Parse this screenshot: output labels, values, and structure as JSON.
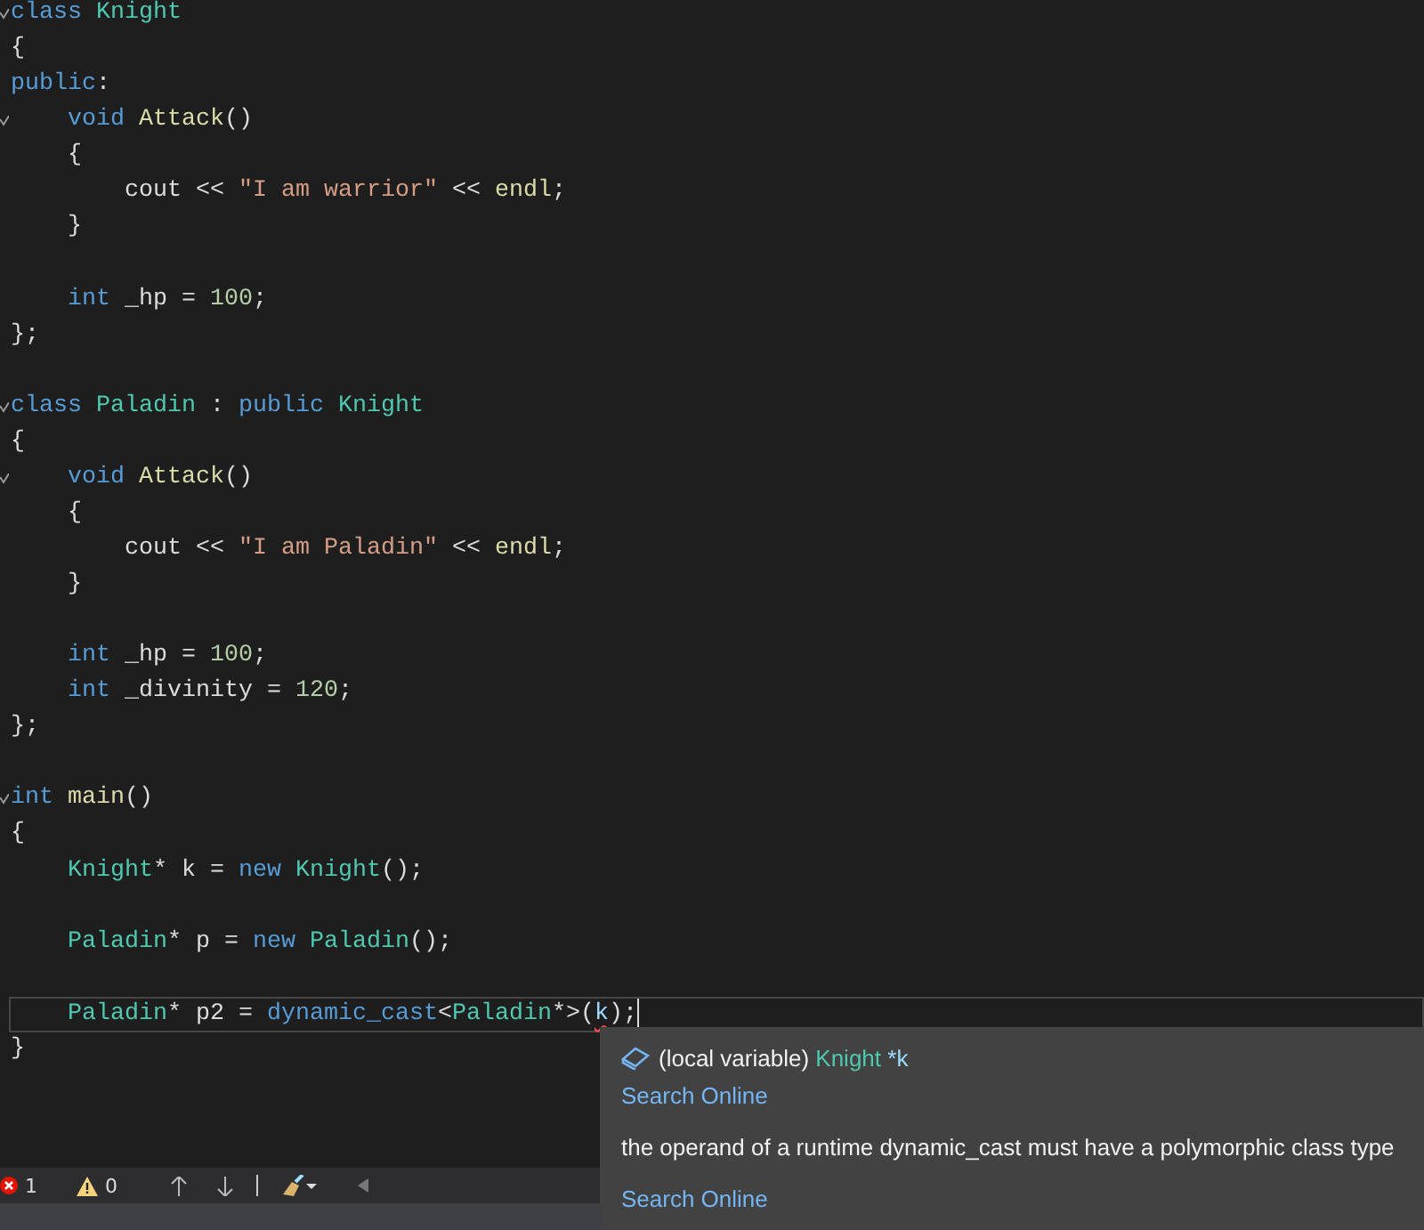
{
  "editor": {
    "lines": [
      {
        "fold": true,
        "current": false,
        "tokens": [
          {
            "kind": "keyword",
            "text": "class "
          },
          {
            "kind": "type",
            "text": "Knight"
          }
        ]
      },
      {
        "fold": false,
        "current": false,
        "tokens": [
          {
            "kind": "plain",
            "text": "{"
          }
        ]
      },
      {
        "fold": false,
        "current": false,
        "tokens": [
          {
            "kind": "keyword",
            "text": "public"
          },
          {
            "kind": "plain",
            "text": ":"
          }
        ]
      },
      {
        "fold": true,
        "current": false,
        "tokens": [
          {
            "kind": "keyword",
            "text": "    void "
          },
          {
            "kind": "func",
            "text": "Attack"
          },
          {
            "kind": "plain",
            "text": "()"
          }
        ]
      },
      {
        "fold": false,
        "current": false,
        "tokens": [
          {
            "kind": "plain",
            "text": "    {"
          }
        ]
      },
      {
        "fold": false,
        "current": false,
        "tokens": [
          {
            "kind": "plain",
            "text": "        cout << "
          },
          {
            "kind": "string",
            "text": "\"I am warrior\""
          },
          {
            "kind": "plain",
            "text": " << "
          },
          {
            "kind": "func",
            "text": "endl"
          },
          {
            "kind": "plain",
            "text": ";"
          }
        ]
      },
      {
        "fold": false,
        "current": false,
        "tokens": [
          {
            "kind": "plain",
            "text": "    }"
          }
        ]
      },
      {
        "fold": false,
        "current": false
      },
      {
        "fold": false,
        "current": false,
        "tokens": [
          {
            "kind": "keyword",
            "text": "    int "
          },
          {
            "kind": "plain",
            "text": "_hp = "
          },
          {
            "kind": "number",
            "text": "100"
          },
          {
            "kind": "plain",
            "text": ";"
          }
        ]
      },
      {
        "fold": false,
        "current": false,
        "tokens": [
          {
            "kind": "plain",
            "text": "};"
          }
        ]
      },
      {
        "fold": false,
        "current": false
      },
      {
        "fold": true,
        "current": false,
        "tokens": [
          {
            "kind": "keyword",
            "text": "class "
          },
          {
            "kind": "type",
            "text": "Paladin"
          },
          {
            "kind": "plain",
            "text": " : "
          },
          {
            "kind": "keyword",
            "text": "public "
          },
          {
            "kind": "type",
            "text": "Knight"
          }
        ]
      },
      {
        "fold": false,
        "current": false,
        "tokens": [
          {
            "kind": "plain",
            "text": "{"
          }
        ]
      },
      {
        "fold": true,
        "current": false,
        "tokens": [
          {
            "kind": "keyword",
            "text": "    void "
          },
          {
            "kind": "func",
            "text": "Attack"
          },
          {
            "kind": "plain",
            "text": "()"
          }
        ]
      },
      {
        "fold": false,
        "current": false,
        "tokens": [
          {
            "kind": "plain",
            "text": "    {"
          }
        ]
      },
      {
        "fold": false,
        "current": false,
        "tokens": [
          {
            "kind": "plain",
            "text": "        cout << "
          },
          {
            "kind": "string",
            "text": "\"I am Paladin\""
          },
          {
            "kind": "plain",
            "text": " << "
          },
          {
            "kind": "func",
            "text": "endl"
          },
          {
            "kind": "plain",
            "text": ";"
          }
        ]
      },
      {
        "fold": false,
        "current": false,
        "tokens": [
          {
            "kind": "plain",
            "text": "    }"
          }
        ]
      },
      {
        "fold": false,
        "current": false
      },
      {
        "fold": false,
        "current": false,
        "tokens": [
          {
            "kind": "keyword",
            "text": "    int "
          },
          {
            "kind": "plain",
            "text": "_hp = "
          },
          {
            "kind": "number",
            "text": "100"
          },
          {
            "kind": "plain",
            "text": ";"
          }
        ]
      },
      {
        "fold": false,
        "current": false,
        "tokens": [
          {
            "kind": "keyword",
            "text": "    int "
          },
          {
            "kind": "plain",
            "text": "_divinity = "
          },
          {
            "kind": "number",
            "text": "120"
          },
          {
            "kind": "plain",
            "text": ";"
          }
        ]
      },
      {
        "fold": false,
        "current": false,
        "tokens": [
          {
            "kind": "plain",
            "text": "};"
          }
        ]
      },
      {
        "fold": false,
        "current": false
      },
      {
        "fold": true,
        "current": false,
        "tokens": [
          {
            "kind": "keyword",
            "text": "int "
          },
          {
            "kind": "func",
            "text": "main"
          },
          {
            "kind": "plain",
            "text": "()"
          }
        ]
      },
      {
        "fold": false,
        "current": false,
        "tokens": [
          {
            "kind": "plain",
            "text": "{"
          }
        ]
      },
      {
        "fold": false,
        "current": false,
        "tokens": [
          {
            "kind": "type",
            "text": "    Knight"
          },
          {
            "kind": "plain",
            "text": "* k = "
          },
          {
            "kind": "keyword",
            "text": "new "
          },
          {
            "kind": "type",
            "text": "Knight"
          },
          {
            "kind": "plain",
            "text": "();"
          }
        ]
      },
      {
        "fold": false,
        "current": false
      },
      {
        "fold": false,
        "current": false,
        "tokens": [
          {
            "kind": "type",
            "text": "    Paladin"
          },
          {
            "kind": "plain",
            "text": "* p = "
          },
          {
            "kind": "keyword",
            "text": "new "
          },
          {
            "kind": "type",
            "text": "Paladin"
          },
          {
            "kind": "plain",
            "text": "();"
          }
        ]
      },
      {
        "fold": false,
        "current": false
      },
      {
        "fold": false,
        "current": true,
        "tokens": [
          {
            "kind": "type",
            "text": "    Paladin"
          },
          {
            "kind": "plain",
            "text": "* p2 = "
          },
          {
            "kind": "keyword",
            "text": "dynamic_cast"
          },
          {
            "kind": "plain",
            "text": "<"
          },
          {
            "kind": "type",
            "text": "Paladin"
          },
          {
            "kind": "plain",
            "text": "*>("
          },
          {
            "kind": "error",
            "text": "k"
          },
          {
            "kind": "plain",
            "text": ");"
          }
        ]
      },
      {
        "fold": false,
        "current": false,
        "tokens": [
          {
            "kind": "plain",
            "text": "}"
          }
        ]
      }
    ]
  },
  "tooltip": {
    "signature": [
      {
        "kind": "plain",
        "text": "(local variable) "
      },
      {
        "kind": "type",
        "text": "Knight"
      },
      {
        "kind": "param",
        "text": " *k"
      }
    ],
    "link_1": "Search Online",
    "message": "the operand of a runtime dynamic_cast must have a polymorphic class type",
    "link_2": "Search Online"
  },
  "status_bar": {
    "errors": "1",
    "warnings": "0"
  }
}
